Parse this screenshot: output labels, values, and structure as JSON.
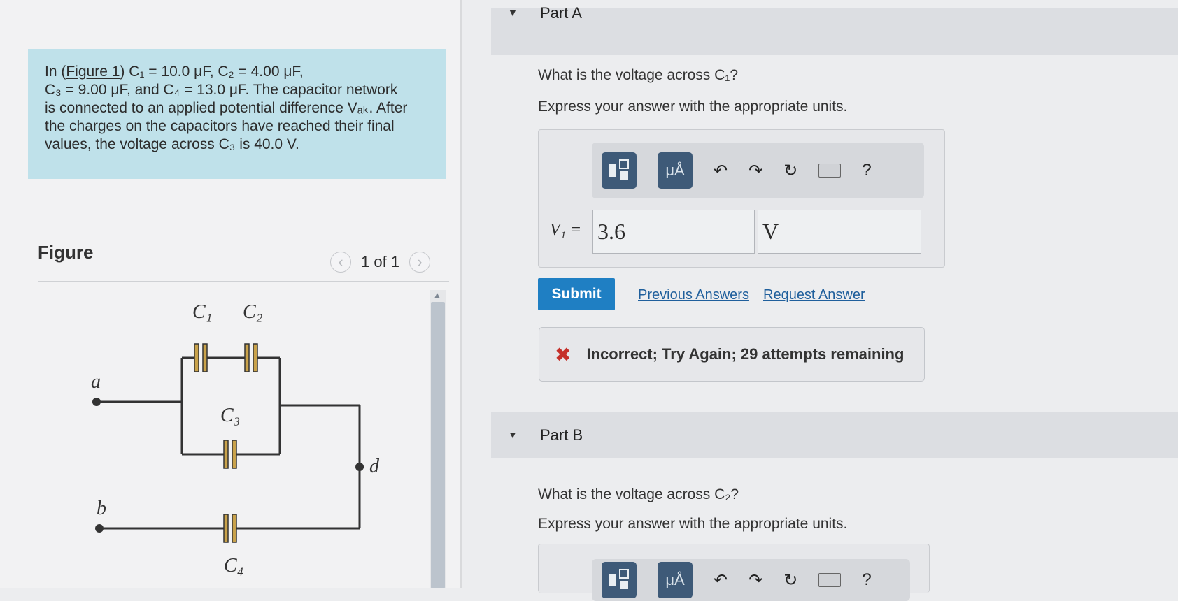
{
  "problem": {
    "intro": "In (",
    "figure_link": "Figure 1",
    "line1_rest": ") C₁ = 10.0 μF, C₂ = 4.00 μF,",
    "line2": "C₃ = 9.00 μF, and C₄ = 13.0 μF. The capacitor network",
    "line3": "is connected to an applied potential difference Vₐₖ. After",
    "line4": "the charges on the capacitors have reached their final",
    "line5": "values, the voltage across C₃ is 40.0 V."
  },
  "figure": {
    "label": "Figure",
    "pager": "1 of 1",
    "prev_icon": "chevron-left-icon",
    "next_icon": "chevron-right-icon",
    "circuit": {
      "c1": "C₁",
      "c2": "C₂",
      "c3": "C₃",
      "c4": "C₄",
      "a": "a",
      "b": "b",
      "d": "d"
    }
  },
  "partA": {
    "title": "Part A",
    "question": "What is the voltage across C₁?",
    "instruction": "Express your answer with the appropriate units.",
    "toolbar": {
      "units_label": "μÅ",
      "help": "?"
    },
    "var_label": "V₁ =",
    "value": "3.6",
    "unit": "V",
    "submit": "Submit",
    "previous_answers": "Previous Answers",
    "request_answer": "Request Answer",
    "feedback": "Incorrect; Try Again; 29 attempts remaining"
  },
  "partB": {
    "title": "Part B",
    "question": "What is the voltage across C₂?",
    "instruction": "Express your answer with the appropriate units.",
    "toolbar": {
      "units_label": "μÅ",
      "help": "?"
    }
  },
  "colors": {
    "problem_bg": "#bfe1ea",
    "submit_bg": "#1f7fc3",
    "toolbar_btn": "#3e5a78",
    "error": "#c5302a",
    "capacitor": "#c9a24a"
  }
}
